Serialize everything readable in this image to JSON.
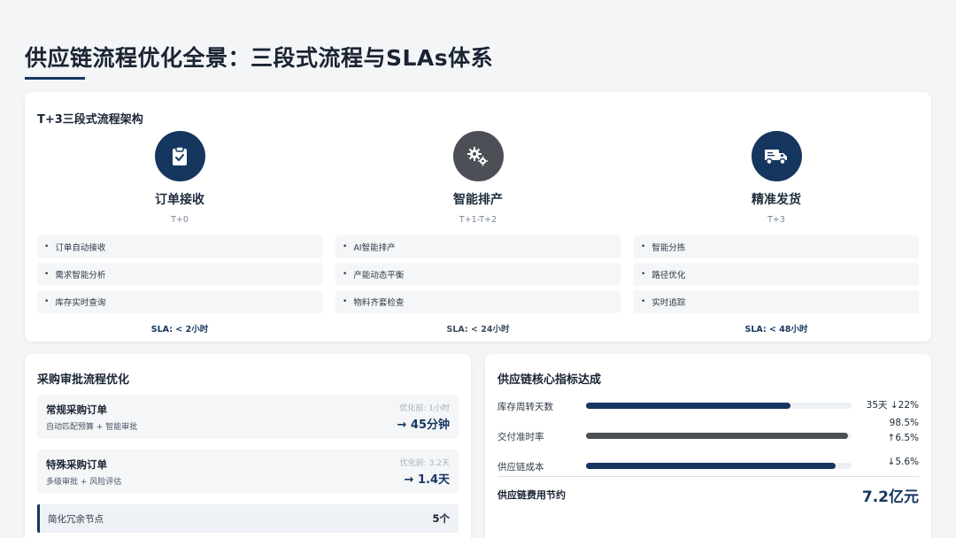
{
  "page": {
    "title": "供应链流程优化全景：三段式流程与SLAs体系"
  },
  "process": {
    "title": "T+3三段式流程架构",
    "stages": [
      {
        "name": "订单接收",
        "time": "T+0",
        "icon": "clipboard-check-icon",
        "color": "#15365f",
        "items": [
          "订单自动接收",
          "需求智能分析",
          "库存实时查询"
        ],
        "sla": "SLA: < 2小时",
        "sla_color": "#15365f"
      },
      {
        "name": "智能排产",
        "time": "T+1-T+2",
        "icon": "gears-icon",
        "color": "#4c5056",
        "items": [
          "AI智能排产",
          "产能动态平衡",
          "物料齐套检查"
        ],
        "sla": "SLA: < 24小时",
        "sla_color": "#3d4a59"
      },
      {
        "name": "精准发货",
        "time": "T+3",
        "icon": "truck-icon",
        "color": "#15365f",
        "items": [
          "智能分拣",
          "路径优化",
          "实时追踪"
        ],
        "sla": "SLA: < 48小时",
        "sla_color": "#15365f"
      }
    ]
  },
  "approval": {
    "title": "采购审批流程优化",
    "items": [
      {
        "title": "常规采购订单",
        "desc": "自动匹配预算 + 智能审批",
        "before": "优化前: 1小时",
        "after": "→ 45分钟"
      },
      {
        "title": "特殊采购订单",
        "desc": "多级审批 + 风险评估",
        "before": "优化前: 3.2天",
        "after": "→ 1.4天"
      }
    ],
    "summary": {
      "label": "简化冗余节点",
      "value": "5个"
    }
  },
  "metrics": {
    "title": "供应链核心指标达成",
    "items": [
      {
        "label": "库存周转天数",
        "value_line1": "35天 ↓22%",
        "value_line2": "",
        "progress": 0.77,
        "color": "#15365f"
      },
      {
        "label": "交付准时率",
        "value_line1": "98.5%",
        "value_line2": "↑6.5%",
        "progress": 0.985,
        "color": "#4c5056"
      },
      {
        "label": "供应链成本",
        "value_line1": "↓5.6%",
        "value_line2": "",
        "progress": 0.94,
        "color": "#15365f"
      }
    ],
    "saving_label": "供应链费用节约",
    "saving_value": "7.2亿元"
  }
}
